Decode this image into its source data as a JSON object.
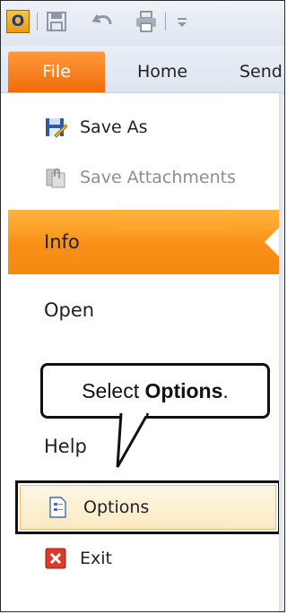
{
  "quick_access": {
    "icons": [
      "outlook-icon",
      "save-icon",
      "undo-icon",
      "print-icon",
      "customize-icon"
    ]
  },
  "ribbon": {
    "tabs": [
      "File",
      "Home",
      "Send"
    ]
  },
  "backstage": {
    "commands": {
      "save_as": "Save As",
      "save_attachments": "Save Attachments",
      "options": "Options",
      "exit": "Exit"
    },
    "nav": {
      "info": "Info",
      "open": "Open",
      "help": "Help"
    }
  },
  "callout": {
    "prefix": "Select ",
    "bold": "Options",
    "suffix": "."
  },
  "colors": {
    "file_tab": "#f06c08",
    "info_highlight": "#f98f16",
    "options_hover": "#fbe9c2"
  }
}
